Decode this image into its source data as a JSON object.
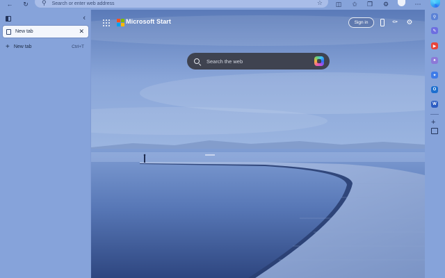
{
  "toolbar": {
    "back_icon": "arrow-left-icon",
    "refresh_icon": "refresh-icon",
    "address_placeholder": "Search or enter web address",
    "icons": [
      "favorite-star-icon",
      "split-screen-icon",
      "favorites-icon",
      "collections-icon",
      "extensions-icon",
      "copilot-icon",
      "profile-avatar"
    ]
  },
  "tabs_panel": {
    "tabs": [
      {
        "label": "New tab",
        "active": true
      }
    ],
    "new_tab": {
      "label": "New tab",
      "shortcut": "Ctrl+T"
    }
  },
  "page": {
    "brand": "Microsoft Start",
    "sign_in": "Sign in",
    "search_placeholder": "Search the web"
  },
  "edge_sidebar": {
    "apps": [
      "search-icon",
      "pen-icon",
      "youtube-icon",
      "games-icon",
      "copilot-app-icon",
      "outlook-icon",
      "word-icon"
    ],
    "add_label": "+"
  },
  "colors": {
    "accent": "#2b6ff5",
    "ms_red": "#f25022",
    "ms_green": "#7fba00",
    "ms_blue": "#00a4ef",
    "ms_yellow": "#ffb900"
  }
}
